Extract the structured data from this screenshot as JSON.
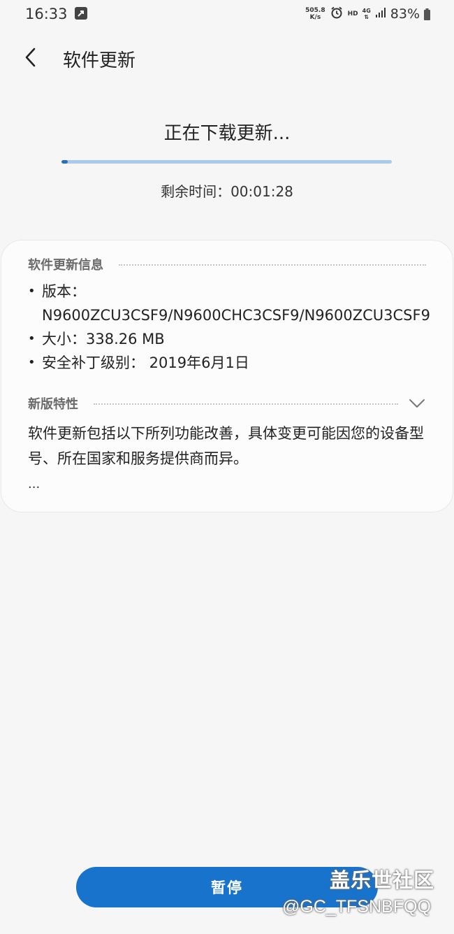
{
  "status_bar": {
    "time": "16:33",
    "net_speed_value": "505.8",
    "net_speed_unit": "K/s",
    "hd_label": "HD",
    "network_type": "4G",
    "battery_percent": "83%"
  },
  "header": {
    "title": "软件更新"
  },
  "download": {
    "status": "正在下载更新...",
    "progress": 0.02,
    "time_remaining": "剩余时间：00:01:28"
  },
  "update_info": {
    "section_title": "软件更新信息",
    "items": [
      "版本：N9600ZCU3CSF9/N9600CHC3CSF9/N9600ZCU3CSF9",
      "大小：338.26 MB",
      "安全补丁级别： 2019年6月1日"
    ]
  },
  "features": {
    "section_title": "新版特性",
    "text": "软件更新包括以下所列功能改善，具体变更可能因您的设备型号、所在国家和服务提供商而异。",
    "ellipsis": "..."
  },
  "actions": {
    "pause_label": "暂停"
  },
  "watermark": {
    "title": "盖乐世社区",
    "handle": "@GC_TFSNBFQQ"
  },
  "colors": {
    "accent": "#1873cd",
    "progress_track": "#a9cbea",
    "progress_fill": "#2a6fbf",
    "background": "#f6f6f6",
    "card": "#fcfcfc"
  },
  "icons": {
    "back": "chevron-left-icon",
    "notification": "notification-icon",
    "alarm": "alarm-icon",
    "signal": "signal-icon",
    "battery": "battery-icon",
    "expand": "chevron-down-icon"
  }
}
